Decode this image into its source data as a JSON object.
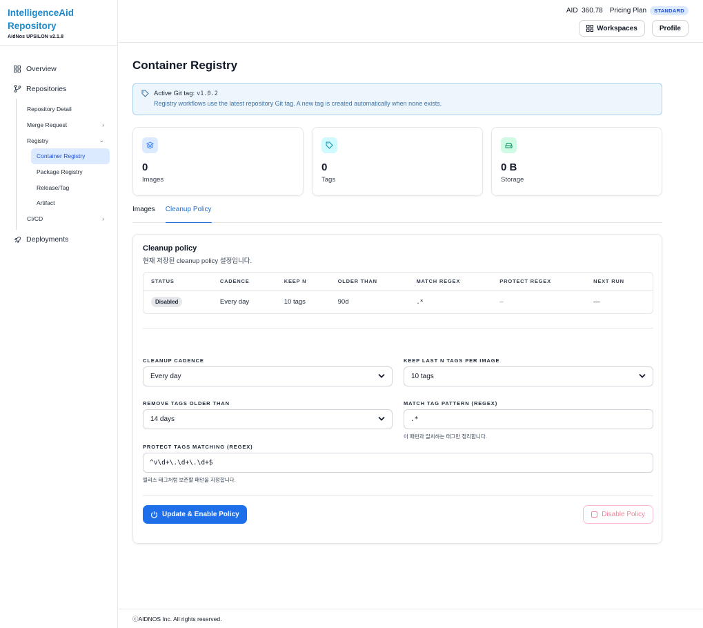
{
  "brand": {
    "title": "IntelligenceAid Repository",
    "version": "AidNos UPSILON v2.1.8"
  },
  "nav": {
    "overview": "Overview",
    "repositories": "Repositories",
    "repo_sub": {
      "repository_detail": "Repository Detail",
      "merge_request": "Merge Request",
      "registry": "Registry",
      "registry_items": [
        "Container Registry",
        "Package Registry",
        "Release/Tag",
        "Artifact"
      ],
      "cicd": "CI/CD"
    },
    "deployments": "Deployments"
  },
  "header": {
    "aid_label": "AID",
    "aid_value": "360.78",
    "pricing_label": "Pricing Plan",
    "plan_badge": "STANDARD",
    "workspaces": "Workspaces",
    "profile": "Profile"
  },
  "page": {
    "title": "Container Registry",
    "git_banner": {
      "label": "Active Git tag:",
      "tag": "v1.0.2",
      "description": "Registry workflows use the latest repository Git tag. A new tag is created automatically when none exists."
    },
    "stats": [
      {
        "value": "0",
        "label": "Images",
        "icon": "layers-icon",
        "color": "#dbeafe",
        "icon_color": "#3b82f6"
      },
      {
        "value": "0",
        "label": "Tags",
        "icon": "tag-icon",
        "color": "#cffafe",
        "icon_color": "#0891b2"
      },
      {
        "value": "0 B",
        "label": "Storage",
        "icon": "hard-drive-icon",
        "color": "#d1fae5",
        "icon_color": "#059669"
      }
    ],
    "tabs": [
      "Images",
      "Cleanup Policy"
    ],
    "active_tab": "Cleanup Policy"
  },
  "policy": {
    "title": "Cleanup policy",
    "subtitle": "현재 저장된 cleanup policy 설정입니다.",
    "columns": [
      "STATUS",
      "CADENCE",
      "KEEP N",
      "OLDER THAN",
      "MATCH REGEX",
      "PROTECT REGEX",
      "NEXT RUN"
    ],
    "row": {
      "status": "Disabled",
      "cadence": "Every day",
      "keep_n": "10 tags",
      "older_than": "90d",
      "match_regex": ".*",
      "protect_regex": "–",
      "next_run": "—"
    }
  },
  "form": {
    "cadence_label": "CLEANUP CADENCE",
    "cadence_value": "Every day",
    "keep_label": "KEEP LAST N TAGS PER IMAGE",
    "keep_value": "10 tags",
    "older_label": "REMOVE TAGS OLDER THAN",
    "older_value": "14 days",
    "match_label": "MATCH TAG PATTERN (REGEX)",
    "match_value": ".*",
    "match_hint": "이 패턴과 일치하는 태그만 정리합니다.",
    "protect_label": "PROTECT TAGS MATCHING (REGEX)",
    "protect_value": "^v\\d+\\.\\d+\\.\\d+$",
    "protect_hint": "릴리스 태그처럼 보존할 패턴을 지정합니다.",
    "update_button": "Update & Enable Policy",
    "disable_button": "Disable Policy"
  },
  "footer": {
    "text": "ⓒAIDNOS Inc. All rights reserved."
  }
}
